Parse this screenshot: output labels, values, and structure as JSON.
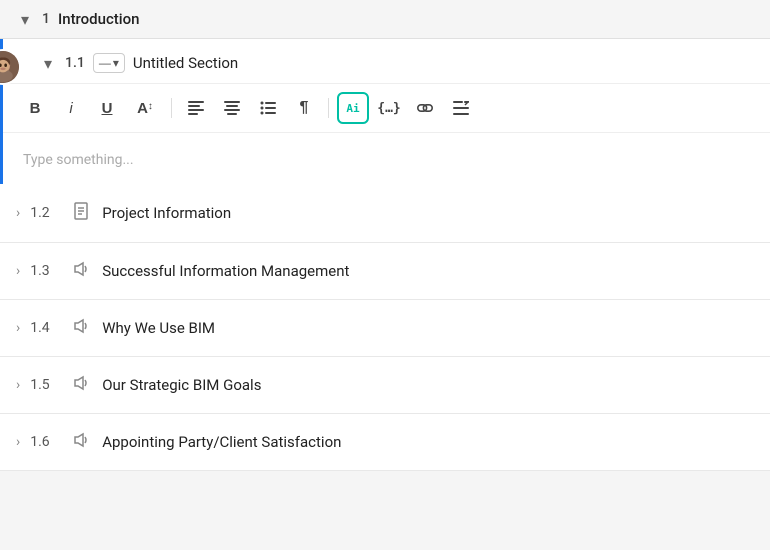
{
  "mainSection": {
    "number": "1",
    "title": "Introduction",
    "chevron": "▾"
  },
  "subsection": {
    "number": "1.1",
    "title": "Untitled Section",
    "chevron": "▾",
    "dropdownLabel": "—",
    "placeholder": "Type something..."
  },
  "toolbar": {
    "bold": "B",
    "italic": "i",
    "underline": "U",
    "fontSize": "A↕",
    "alignLeft": "≡",
    "alignCenter": "≡",
    "listBullet": "☰",
    "paragraph": "¶",
    "ai": "Ai",
    "code": "{…}",
    "link": "⊕",
    "more": "+≡"
  },
  "sections": [
    {
      "number": "1.2",
      "title": "Project Information",
      "hasDocIcon": true
    },
    {
      "number": "1.3",
      "title": "Successful Information Management",
      "hasDocIcon": false
    },
    {
      "number": "1.4",
      "title": "Why We Use BIM",
      "hasDocIcon": false
    },
    {
      "number": "1.5",
      "title": "Our Strategic BIM Goals",
      "hasDocIcon": false
    },
    {
      "number": "1.6",
      "title": "Appointing Party/Client Satisfaction",
      "hasDocIcon": false
    }
  ],
  "colors": {
    "accent": "#1a73e8",
    "aiColor": "#00bfa5"
  }
}
